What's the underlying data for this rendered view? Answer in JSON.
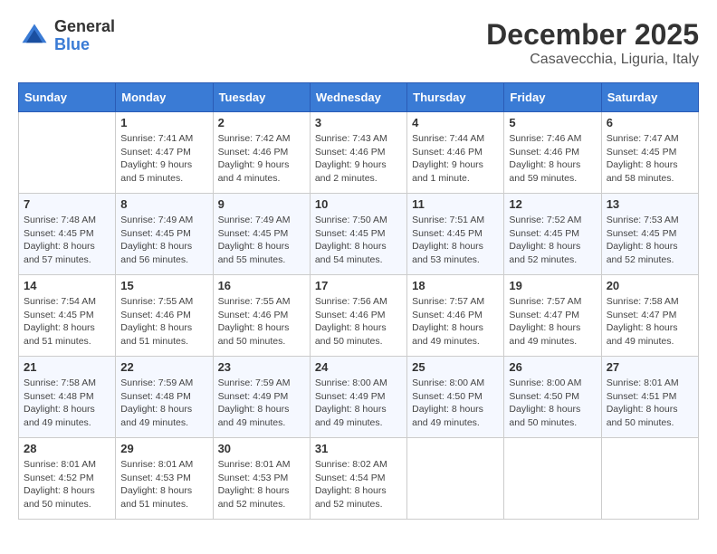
{
  "header": {
    "logo_line1": "General",
    "logo_line2": "Blue",
    "month": "December 2025",
    "location": "Casavecchia, Liguria, Italy"
  },
  "weekdays": [
    "Sunday",
    "Monday",
    "Tuesday",
    "Wednesday",
    "Thursday",
    "Friday",
    "Saturday"
  ],
  "weeks": [
    [
      {
        "day": "",
        "info": ""
      },
      {
        "day": "1",
        "info": "Sunrise: 7:41 AM\nSunset: 4:47 PM\nDaylight: 9 hours\nand 5 minutes."
      },
      {
        "day": "2",
        "info": "Sunrise: 7:42 AM\nSunset: 4:46 PM\nDaylight: 9 hours\nand 4 minutes."
      },
      {
        "day": "3",
        "info": "Sunrise: 7:43 AM\nSunset: 4:46 PM\nDaylight: 9 hours\nand 2 minutes."
      },
      {
        "day": "4",
        "info": "Sunrise: 7:44 AM\nSunset: 4:46 PM\nDaylight: 9 hours\nand 1 minute."
      },
      {
        "day": "5",
        "info": "Sunrise: 7:46 AM\nSunset: 4:46 PM\nDaylight: 8 hours\nand 59 minutes."
      },
      {
        "day": "6",
        "info": "Sunrise: 7:47 AM\nSunset: 4:45 PM\nDaylight: 8 hours\nand 58 minutes."
      }
    ],
    [
      {
        "day": "7",
        "info": "Sunrise: 7:48 AM\nSunset: 4:45 PM\nDaylight: 8 hours\nand 57 minutes."
      },
      {
        "day": "8",
        "info": "Sunrise: 7:49 AM\nSunset: 4:45 PM\nDaylight: 8 hours\nand 56 minutes."
      },
      {
        "day": "9",
        "info": "Sunrise: 7:49 AM\nSunset: 4:45 PM\nDaylight: 8 hours\nand 55 minutes."
      },
      {
        "day": "10",
        "info": "Sunrise: 7:50 AM\nSunset: 4:45 PM\nDaylight: 8 hours\nand 54 minutes."
      },
      {
        "day": "11",
        "info": "Sunrise: 7:51 AM\nSunset: 4:45 PM\nDaylight: 8 hours\nand 53 minutes."
      },
      {
        "day": "12",
        "info": "Sunrise: 7:52 AM\nSunset: 4:45 PM\nDaylight: 8 hours\nand 52 minutes."
      },
      {
        "day": "13",
        "info": "Sunrise: 7:53 AM\nSunset: 4:45 PM\nDaylight: 8 hours\nand 52 minutes."
      }
    ],
    [
      {
        "day": "14",
        "info": "Sunrise: 7:54 AM\nSunset: 4:45 PM\nDaylight: 8 hours\nand 51 minutes."
      },
      {
        "day": "15",
        "info": "Sunrise: 7:55 AM\nSunset: 4:46 PM\nDaylight: 8 hours\nand 51 minutes."
      },
      {
        "day": "16",
        "info": "Sunrise: 7:55 AM\nSunset: 4:46 PM\nDaylight: 8 hours\nand 50 minutes."
      },
      {
        "day": "17",
        "info": "Sunrise: 7:56 AM\nSunset: 4:46 PM\nDaylight: 8 hours\nand 50 minutes."
      },
      {
        "day": "18",
        "info": "Sunrise: 7:57 AM\nSunset: 4:46 PM\nDaylight: 8 hours\nand 49 minutes."
      },
      {
        "day": "19",
        "info": "Sunrise: 7:57 AM\nSunset: 4:47 PM\nDaylight: 8 hours\nand 49 minutes."
      },
      {
        "day": "20",
        "info": "Sunrise: 7:58 AM\nSunset: 4:47 PM\nDaylight: 8 hours\nand 49 minutes."
      }
    ],
    [
      {
        "day": "21",
        "info": "Sunrise: 7:58 AM\nSunset: 4:48 PM\nDaylight: 8 hours\nand 49 minutes."
      },
      {
        "day": "22",
        "info": "Sunrise: 7:59 AM\nSunset: 4:48 PM\nDaylight: 8 hours\nand 49 minutes."
      },
      {
        "day": "23",
        "info": "Sunrise: 7:59 AM\nSunset: 4:49 PM\nDaylight: 8 hours\nand 49 minutes."
      },
      {
        "day": "24",
        "info": "Sunrise: 8:00 AM\nSunset: 4:49 PM\nDaylight: 8 hours\nand 49 minutes."
      },
      {
        "day": "25",
        "info": "Sunrise: 8:00 AM\nSunset: 4:50 PM\nDaylight: 8 hours\nand 49 minutes."
      },
      {
        "day": "26",
        "info": "Sunrise: 8:00 AM\nSunset: 4:50 PM\nDaylight: 8 hours\nand 50 minutes."
      },
      {
        "day": "27",
        "info": "Sunrise: 8:01 AM\nSunset: 4:51 PM\nDaylight: 8 hours\nand 50 minutes."
      }
    ],
    [
      {
        "day": "28",
        "info": "Sunrise: 8:01 AM\nSunset: 4:52 PM\nDaylight: 8 hours\nand 50 minutes."
      },
      {
        "day": "29",
        "info": "Sunrise: 8:01 AM\nSunset: 4:53 PM\nDaylight: 8 hours\nand 51 minutes."
      },
      {
        "day": "30",
        "info": "Sunrise: 8:01 AM\nSunset: 4:53 PM\nDaylight: 8 hours\nand 52 minutes."
      },
      {
        "day": "31",
        "info": "Sunrise: 8:02 AM\nSunset: 4:54 PM\nDaylight: 8 hours\nand 52 minutes."
      },
      {
        "day": "",
        "info": ""
      },
      {
        "day": "",
        "info": ""
      },
      {
        "day": "",
        "info": ""
      }
    ]
  ]
}
